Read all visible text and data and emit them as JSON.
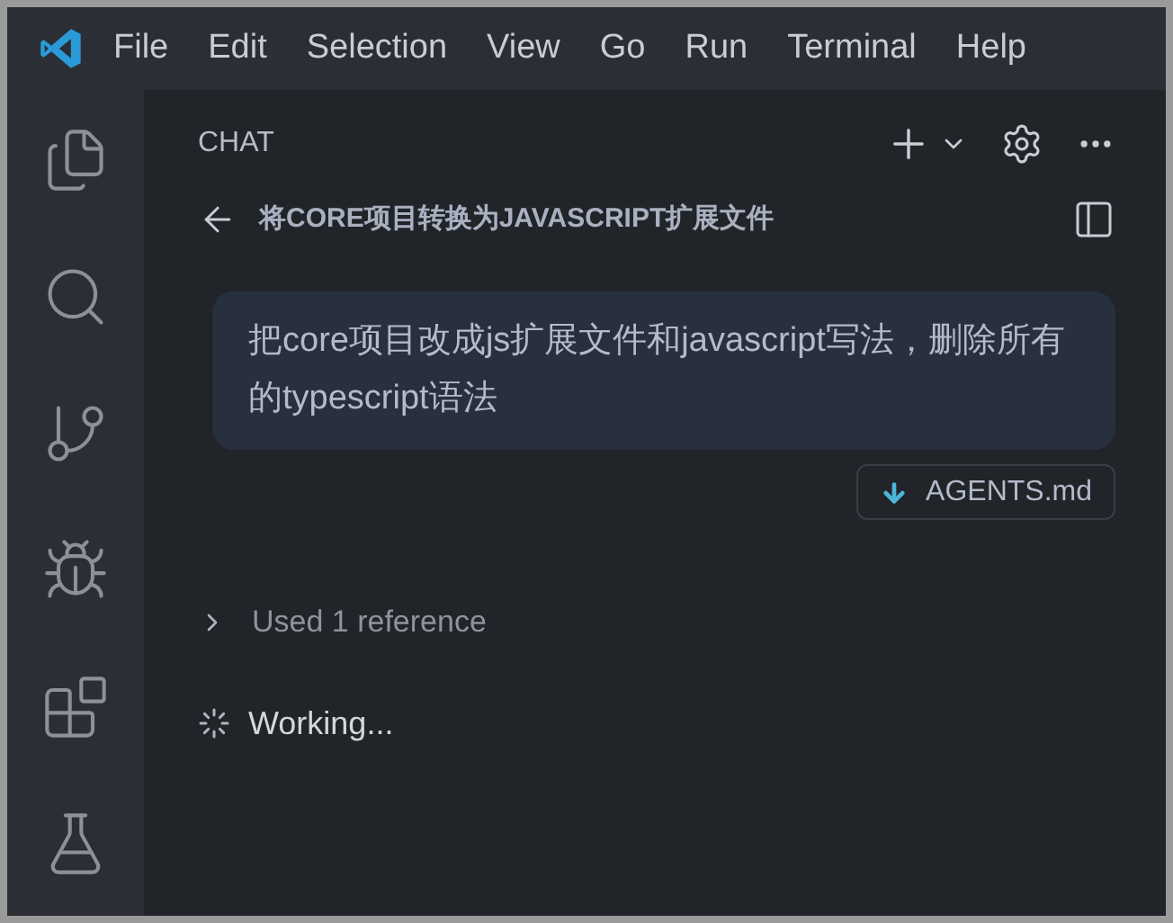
{
  "menu_bar": [
    "File",
    "Edit",
    "Selection",
    "View",
    "Go",
    "Run",
    "Terminal",
    "Help"
  ],
  "activity_bar": [
    {
      "kind": "files"
    },
    {
      "kind": "search"
    },
    {
      "kind": "source-control"
    },
    {
      "kind": "run-debug"
    },
    {
      "kind": "extensions"
    },
    {
      "kind": "testing"
    }
  ],
  "chat": {
    "header": "CHAT",
    "title": "将CORE项目转换为JAVASCRIPT扩展文件",
    "request": "把core项目改成js扩展文件和javascript写法，删除所有的typescript语法",
    "attachment": "AGENTS.md",
    "references": {
      "label": "Used 1 reference",
      "expanded": false
    },
    "status": "Working..."
  }
}
